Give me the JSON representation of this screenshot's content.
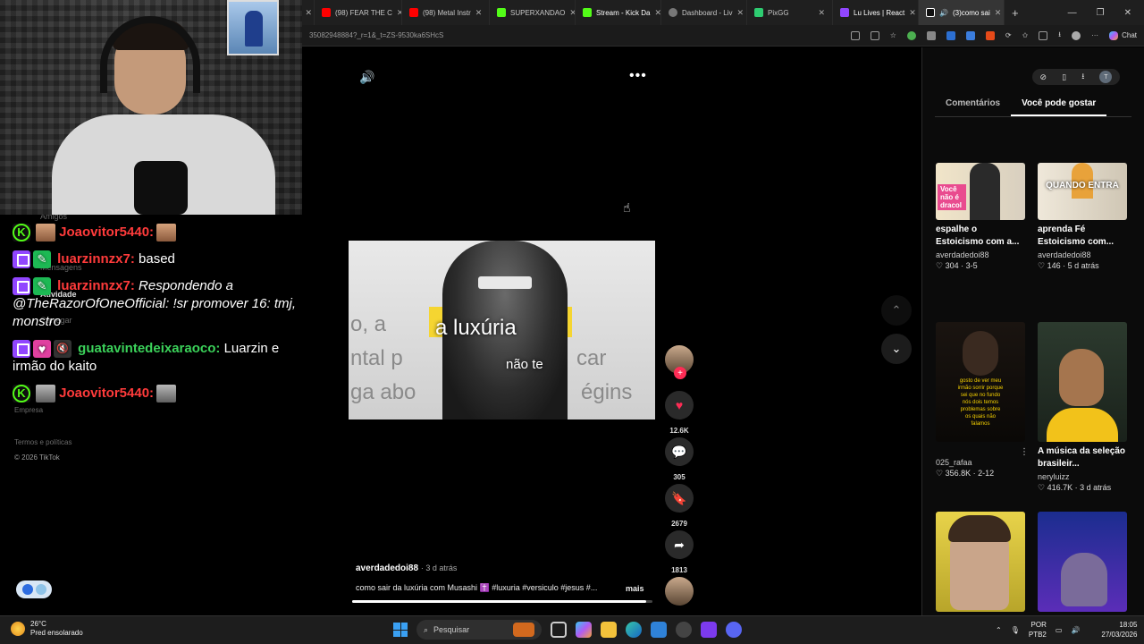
{
  "browser": {
    "tabs": [
      {
        "label": "(98) FEAR THE C",
        "color": "#ff0000",
        "active": false
      },
      {
        "label": "(98) Metal Instr",
        "color": "#ff0000",
        "active": false
      },
      {
        "label": "SUPERXANDAO",
        "color": "#53fc18",
        "active": false
      },
      {
        "label": "Stream - Kick Da",
        "color": "#53fc18",
        "active": false
      },
      {
        "label": "Dashboard - Liv",
        "color": "#888888",
        "active": false
      },
      {
        "label": "PixGG",
        "color": "#2ecc71",
        "active": false
      },
      {
        "label": "Lu Lives | React",
        "color": "#9146ff",
        "active": false
      },
      {
        "label": "(3)como sai",
        "color": "#ffffff",
        "active": true
      }
    ],
    "url": "35082948884?_r=1&_t=ZS-9530ka6SHcS",
    "chat_label": "Chat"
  },
  "left_page": {
    "ghost_items": [
      "Amigos",
      "Mensagens",
      "Atividade",
      "Carregar",
      "Empresa",
      "Termos e políticas"
    ],
    "copyright": "© 2026 TikTok"
  },
  "chat": {
    "messages": [
      {
        "user": "Joaovitor5440:",
        "text": ""
      },
      {
        "user": "luarzinnzx7:",
        "text": "based"
      },
      {
        "user": "luarzinnzx7:",
        "text": "Respondendo a @TheRazorOfOneOfficial: !sr promover 16: tmj, monstro"
      },
      {
        "user": "guatavintedeixaraoco:",
        "text": "Luarzin e irmão do kaito"
      },
      {
        "user": "Joaovitor5440:",
        "text": ""
      }
    ]
  },
  "video": {
    "caption_main": "a luxúria",
    "caption_sub": "não te",
    "bg_text_1": "o, a",
    "bg_text_2": "ntal p",
    "bg_text_3": "car",
    "bg_text_4": "ga abo",
    "bg_text_5": "égins",
    "author": "averdadedoi88",
    "ago": "· 3 d atrás",
    "description": "como sair da luxúria com Musashi ✝️ #luxuria #versiculo #jesus #...",
    "more": "mais",
    "progress": 0.98,
    "likes": "12.6K",
    "comments": "305",
    "saves": "2679",
    "shares": "1813"
  },
  "right_panel": {
    "tabs": [
      "Comentários",
      "Você pode gostar"
    ],
    "active_tab": "Você pode gostar",
    "cards": [
      {
        "title": "espalhe o Estoicismo com a...",
        "author": "averdadedoi88",
        "stats": "♡ 304 · 3-5",
        "thumb_text": "Você não é dracol"
      },
      {
        "title": "aprenda Fé Estoicismo com...",
        "author": "averdadedoi88",
        "stats": "♡ 146 · 5 d atrás",
        "thumb_text": "QUANDO ENTRA"
      },
      {
        "title": "",
        "author": "025_rafaa",
        "stats": "♡ 356.8K · 2-12",
        "thumb_text": "gosto de ver meu irmão sorrir porque sei que no fundo nós dois temos problemas sobre os quais não falamos"
      },
      {
        "title": "A música da seleção brasileir...",
        "author": "neryluizz",
        "stats": "♡ 416.7K · 3 d atrás",
        "thumb_text": ""
      },
      {
        "title": "",
        "author": "",
        "stats": "",
        "thumb_text": ""
      },
      {
        "title": "",
        "author": "",
        "stats": "",
        "thumb_text": ""
      }
    ]
  },
  "taskbar": {
    "temperature": "26°C",
    "weather": "Pred ensolarado",
    "search": "Pesquisar",
    "lang1": "POR",
    "lang2": "PTB2",
    "time": "18:05",
    "date": "27/03/2026"
  }
}
